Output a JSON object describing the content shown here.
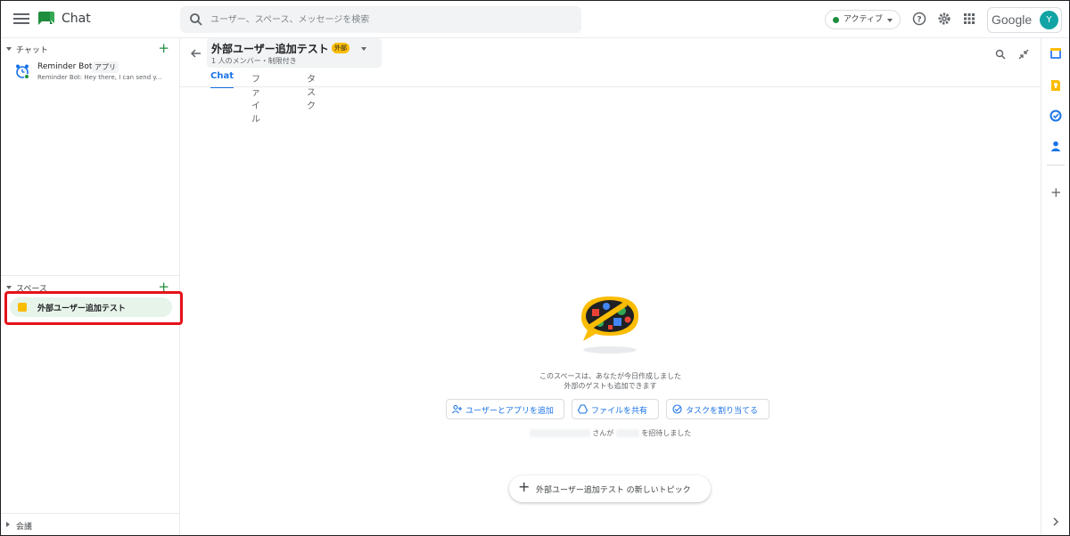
{
  "app": {
    "name": "Chat",
    "search_placeholder": "ユーザー、スペース、メッセージを検索",
    "status_label": "アクティブ",
    "google_label": "Google",
    "avatar_initial": "Y",
    "colors": {
      "accent": "#1a73e8",
      "brand_green": "#1e8e3e",
      "highlight_red": "#e5121a",
      "external_badge": "#fbbc04"
    }
  },
  "sidebar": {
    "chat_section_label": "チャット",
    "chat_items": [
      {
        "name": "Reminder Bot",
        "badge": "アプリ",
        "preview": "Reminder Bot: Hey there, I can send y...",
        "icon": "alarm-clock-icon"
      }
    ],
    "spaces_section_label": "スペース",
    "space_items": [
      {
        "name": "外部ユーザー追加テスト",
        "icon": "space-icon"
      }
    ],
    "meetings_section_label": "会議"
  },
  "room": {
    "title": "外部ユーザー追加テスト",
    "external_badge": "外部",
    "subtitle": "1 人のメンバー・制限付き",
    "tabs": [
      {
        "label": "Chat",
        "active": true
      },
      {
        "label": "ファイル",
        "active": false
      },
      {
        "label": "タスク",
        "active": false
      }
    ]
  },
  "empty_state": {
    "line1": "このスペースは、あなたが今日作成しました",
    "line2": "外部のゲストも追加できます",
    "buttons": [
      {
        "label": "ユーザーとアプリを追加",
        "icon": "add-person-icon"
      },
      {
        "label": "ファイルを共有",
        "icon": "drive-icon"
      },
      {
        "label": "タスクを割り当てる",
        "icon": "task-icon"
      }
    ],
    "invite_part1": "さんが",
    "invite_part2": "を招待しました"
  },
  "composer": {
    "new_topic_label": "外部ユーザー追加テスト の新しいトピック"
  }
}
